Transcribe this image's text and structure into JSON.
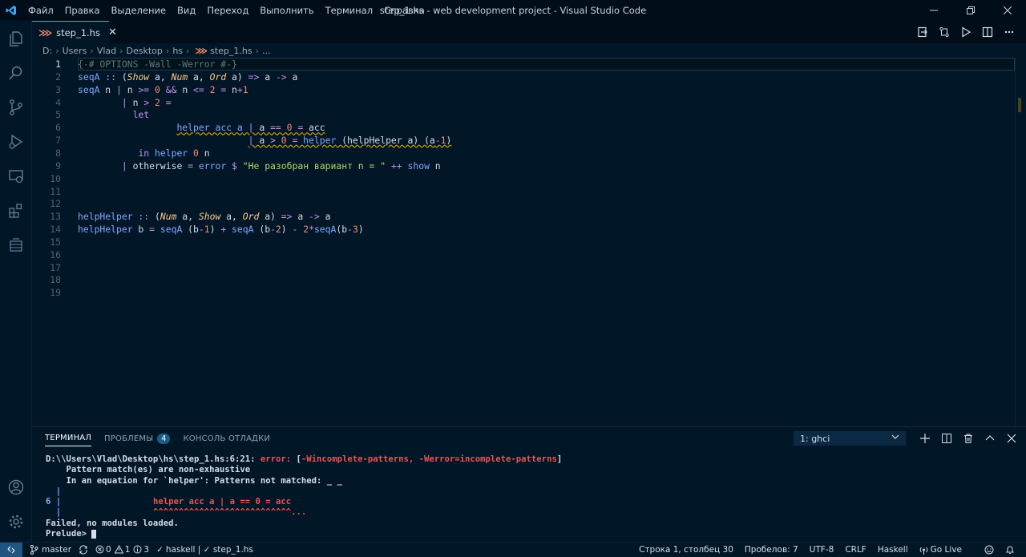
{
  "window": {
    "title": "step_1.hs - web development project - Visual Studio Code",
    "menu": [
      "Файл",
      "Правка",
      "Выделение",
      "Вид",
      "Переход",
      "Выполнить",
      "Терминал",
      "Справка"
    ]
  },
  "tab": {
    "icon_text": "⋙",
    "label": "step_1.hs"
  },
  "breadcrumb": [
    "D:",
    "Users",
    "Vlad",
    "Desktop",
    "hs",
    "step_1.hs",
    "..."
  ],
  "editor": {
    "line_numbers": [
      "1",
      "2",
      "3",
      "4",
      "5",
      "6",
      "7",
      "8",
      "9",
      "10",
      "11",
      "12",
      "13",
      "14",
      "15",
      "16",
      "17",
      "18",
      "19"
    ],
    "lines": [
      {
        "n": "1",
        "parts": [
          [
            "cm",
            "{-# OPTIONS -Wall -Werror #-}"
          ]
        ]
      },
      {
        "n": "2",
        "parts": [
          [
            "fn",
            "seqA"
          ],
          [
            "op",
            " :: "
          ],
          [
            "var",
            "("
          ],
          [
            "ty",
            "Show"
          ],
          [
            "var",
            " a, "
          ],
          [
            "ty",
            "Num"
          ],
          [
            "var",
            " a, "
          ],
          [
            "ty",
            "Ord"
          ],
          [
            "var",
            " a) "
          ],
          [
            "op",
            "=>"
          ],
          [
            "var",
            " a "
          ],
          [
            "op",
            "->"
          ],
          [
            "var",
            " a"
          ]
        ]
      },
      {
        "n": "3",
        "parts": [
          [
            "fn",
            "seqA"
          ],
          [
            "var",
            " n "
          ],
          [
            "op",
            "|"
          ],
          [
            "var",
            " n "
          ],
          [
            "op",
            ">="
          ],
          [
            "num",
            " 0"
          ],
          [
            "op",
            " &&"
          ],
          [
            "var",
            " n "
          ],
          [
            "op",
            "<="
          ],
          [
            "num",
            " 2"
          ],
          [
            "op",
            " ="
          ],
          [
            "var",
            " n"
          ],
          [
            "op",
            "+"
          ],
          [
            "num",
            "1"
          ]
        ]
      },
      {
        "n": "4",
        "parts": [
          [
            "var",
            "        "
          ],
          [
            "op",
            "|"
          ],
          [
            "var",
            " n "
          ],
          [
            "op",
            ">"
          ],
          [
            "num",
            " 2"
          ],
          [
            "op",
            " ="
          ]
        ]
      },
      {
        "n": "5",
        "parts": [
          [
            "var",
            "          "
          ],
          [
            "kw",
            "let"
          ]
        ]
      },
      {
        "n": "6",
        "parts": [
          [
            "var",
            "                  "
          ],
          [
            "fn",
            "helper acc a"
          ],
          [
            "op",
            " | "
          ],
          [
            "var",
            "a "
          ],
          [
            "op",
            "=="
          ],
          [
            "num",
            " 0"
          ],
          [
            "op",
            " ="
          ],
          [
            "var",
            " acc"
          ]
        ]
      },
      {
        "n": "7",
        "parts": [
          [
            "var",
            "                               "
          ],
          [
            "op",
            "| "
          ],
          [
            "var",
            "a "
          ],
          [
            "op",
            ">"
          ],
          [
            "num",
            " 0"
          ],
          [
            "op",
            " ="
          ],
          [
            "fn",
            " helper"
          ],
          [
            "var",
            " (helpHelper a) (a"
          ],
          [
            "op",
            "-"
          ],
          [
            "num",
            "1"
          ],
          [
            "var",
            ")"
          ]
        ]
      },
      {
        "n": "8",
        "parts": [
          [
            "var",
            "           "
          ],
          [
            "kw",
            "in"
          ],
          [
            "fn",
            " helper"
          ],
          [
            "num",
            " 0"
          ],
          [
            "var",
            " n"
          ]
        ]
      },
      {
        "n": "9",
        "parts": [
          [
            "var",
            "        "
          ],
          [
            "op",
            "|"
          ],
          [
            "var",
            " otherwise "
          ],
          [
            "op",
            "="
          ],
          [
            "fn",
            " error"
          ],
          [
            "op",
            " $ "
          ],
          [
            "str",
            "\"Не разобран вариант n = \""
          ],
          [
            "op",
            " ++"
          ],
          [
            "fn",
            " show"
          ],
          [
            "var",
            " n"
          ]
        ]
      },
      {
        "n": "10",
        "parts": []
      },
      {
        "n": "11",
        "parts": []
      },
      {
        "n": "12",
        "parts": []
      },
      {
        "n": "13",
        "parts": [
          [
            "fn",
            "helpHelper"
          ],
          [
            "op",
            " :: "
          ],
          [
            "var",
            "("
          ],
          [
            "ty",
            "Num"
          ],
          [
            "var",
            " a, "
          ],
          [
            "ty",
            "Show"
          ],
          [
            "var",
            " a, "
          ],
          [
            "ty",
            "Ord"
          ],
          [
            "var",
            " a) "
          ],
          [
            "op",
            "=>"
          ],
          [
            "var",
            " a "
          ],
          [
            "op",
            "->"
          ],
          [
            "var",
            " a"
          ]
        ]
      },
      {
        "n": "14",
        "parts": [
          [
            "fn",
            "helpHelper"
          ],
          [
            "var",
            " b "
          ],
          [
            "op",
            "="
          ],
          [
            "fn",
            " seqA"
          ],
          [
            "var",
            " (b"
          ],
          [
            "op",
            "-"
          ],
          [
            "num",
            "1"
          ],
          [
            "var",
            ") "
          ],
          [
            "op",
            "+"
          ],
          [
            "fn",
            " seqA"
          ],
          [
            "var",
            " (b"
          ],
          [
            "op",
            "-"
          ],
          [
            "num",
            "2"
          ],
          [
            "var",
            ") "
          ],
          [
            "op",
            "-"
          ],
          [
            "num",
            " 2"
          ],
          [
            "op",
            "*"
          ],
          [
            "fn",
            "seqA"
          ],
          [
            "var",
            "(b"
          ],
          [
            "op",
            "-"
          ],
          [
            "num",
            "3"
          ],
          [
            "var",
            ")"
          ]
        ]
      }
    ]
  },
  "panel": {
    "tabs": [
      "ТЕРМИНАЛ",
      "ПРОБЛЕМЫ",
      "КОНСОЛЬ ОТЛАДКИ"
    ],
    "problems_count": "4",
    "terminal_select": "1: ghci",
    "output": {
      "l1_path": "D:\\\\Users\\Vlad\\Desktop\\hs\\step_1.hs:6:21: ",
      "l1_err": "error:",
      "l1_rest": " [",
      "l1_flags": "-Wincomplete-patterns, -Werror=incomplete-patterns",
      "l1_close": "]",
      "l2": "    Pattern match(es) are non-exhaustive",
      "l3": "    In an equation for `helper': Patterns not matched: _ _",
      "l4_bar": "  |",
      "l5_num": "6 |",
      "l5_code": "                  helper acc a | a == 0 = acc",
      "l6_bar": "  |",
      "l6_carets": "                  ^^^^^^^^^^^^^^^^^^^^^^^^^^^...",
      "l7": "Failed, no modules loaded.",
      "l8": "Prelude> "
    }
  },
  "status": {
    "branch": "master",
    "errors": "0",
    "warnings": "1",
    "infos": "3",
    "haskell": "haskell | ✓ step_1.hs",
    "position": "Строка 1, столбец 30",
    "spaces": "Пробелов: 7",
    "encoding": "UTF-8",
    "eol": "CRLF",
    "language": "Haskell",
    "golive": "Go Live"
  }
}
